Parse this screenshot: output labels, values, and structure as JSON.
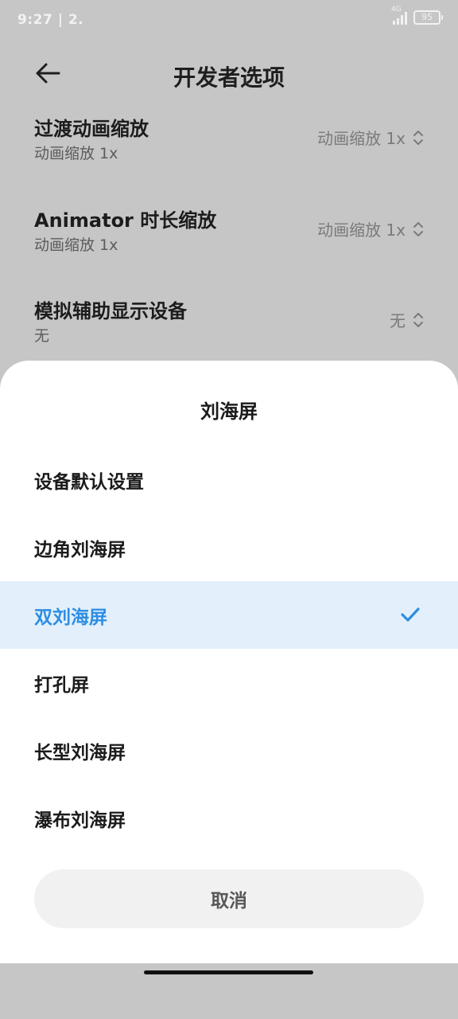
{
  "status_bar": {
    "time": "9:27 | 2.",
    "network": "4G",
    "battery": "95"
  },
  "header": {
    "title": "开发者选项",
    "back_icon": "arrow-left-icon"
  },
  "settings": [
    {
      "title": "过渡动画缩放",
      "subtitle": "动画缩放 1x",
      "value": "动画缩放 1x"
    },
    {
      "title": "Animator 时长缩放",
      "subtitle": "动画缩放 1x",
      "value": "动画缩放 1x"
    },
    {
      "title": "模拟辅助显示设备",
      "subtitle": "无",
      "value": "无"
    }
  ],
  "sheet": {
    "title": "刘海屏",
    "options": [
      {
        "label": "设备默认设置",
        "selected": false
      },
      {
        "label": "边角刘海屏",
        "selected": false
      },
      {
        "label": "双刘海屏",
        "selected": true
      },
      {
        "label": "打孔屏",
        "selected": false
      },
      {
        "label": "长型刘海屏",
        "selected": false
      },
      {
        "label": "瀑布刘海屏",
        "selected": false
      }
    ],
    "cancel_label": "取消"
  },
  "colors": {
    "accent": "#2d8ee3",
    "selected_bg": "#e3f0fb",
    "scrim": "#c6c6c6"
  }
}
